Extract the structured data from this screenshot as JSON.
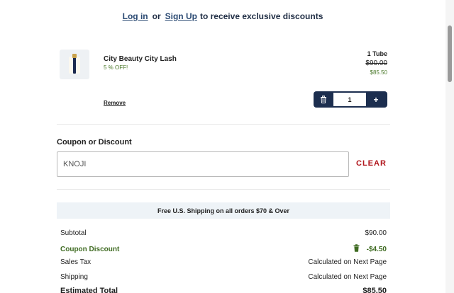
{
  "banner": {
    "login_label": "Log in",
    "or_label": "or",
    "signup_label": "Sign Up",
    "tail_text": "to receive exclusive discounts"
  },
  "cart": {
    "item": {
      "name": "City Beauty City Lash",
      "sale_text": "5 % OFF!",
      "variant": "1 Tube",
      "original_price": "$90.00",
      "sale_price": "$85.50",
      "remove_label": "Remove",
      "quantity": "1",
      "increment_symbol": "+"
    }
  },
  "coupon": {
    "title": "Coupon or Discount",
    "value": "KNOJI",
    "clear_label": "CLEAR"
  },
  "shipping_banner": "Free U.S. Shipping on all orders $70 & Over",
  "summary": {
    "subtotal_label": "Subtotal",
    "subtotal_value": "$90.00",
    "discount_label": "Coupon Discount",
    "discount_value": "-$4.50",
    "tax_label": "Sales Tax",
    "tax_value": "Calculated on Next Page",
    "shipping_label": "Shipping",
    "shipping_value": "Calculated on Next Page",
    "total_label": "Estimated Total",
    "total_value": "$85.50"
  },
  "colors": {
    "navy": "#1c2e4f",
    "sale_green": "#4c7a2c",
    "discount_green": "#3f6b22",
    "clear_red": "#b0161c",
    "banner_bg": "#eef3f7"
  },
  "icons": {
    "stepper_remove": "trash-icon",
    "discount_remove": "trash-icon"
  }
}
